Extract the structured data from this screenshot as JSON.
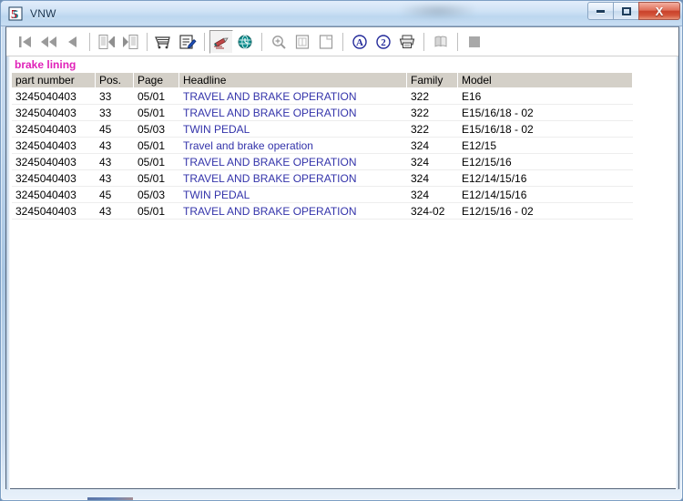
{
  "window": {
    "title": "VNW",
    "app_icon": "app-5-icon",
    "controls": {
      "minimize": "Minimize",
      "maximize": "Maximize",
      "close": "X"
    }
  },
  "toolbar": {
    "buttons": [
      {
        "name": "first-record-button",
        "icon": "skip-to-first-icon",
        "state": "disabled"
      },
      {
        "name": "rewind-button",
        "icon": "rewind-icon",
        "state": "disabled"
      },
      {
        "name": "previous-record-button",
        "icon": "previous-icon",
        "state": "disabled"
      },
      {
        "name": "sep-1",
        "icon": "separator",
        "state": "separator"
      },
      {
        "name": "first-document-button",
        "icon": "document-first-icon",
        "state": "disabled"
      },
      {
        "name": "next-document-button",
        "icon": "document-next-icon",
        "state": "disabled"
      },
      {
        "name": "sep-2",
        "icon": "separator",
        "state": "separator"
      },
      {
        "name": "shopping-cart-button",
        "icon": "shopping-cart-icon",
        "state": "enabled"
      },
      {
        "name": "edit-list-button",
        "icon": "edit-checklist-icon",
        "state": "enabled"
      },
      {
        "name": "sep-3",
        "icon": "separator",
        "state": "separator"
      },
      {
        "name": "annotate-button",
        "icon": "pen-nib-icon",
        "state": "pressed"
      },
      {
        "name": "globe-button",
        "icon": "globe-clock-icon",
        "state": "enabled"
      },
      {
        "name": "sep-4",
        "icon": "separator",
        "state": "separator"
      },
      {
        "name": "zoom-button",
        "icon": "magnifier-plus-icon",
        "state": "disabled"
      },
      {
        "name": "page-view-button",
        "icon": "page-icon",
        "state": "disabled"
      },
      {
        "name": "page-copy-button",
        "icon": "page-copy-icon",
        "state": "disabled"
      },
      {
        "name": "sep-5",
        "icon": "separator",
        "state": "separator"
      },
      {
        "name": "language-a-button",
        "icon": "circled-a-icon",
        "state": "enabled"
      },
      {
        "name": "language-2-button",
        "icon": "circled-2-icon",
        "state": "enabled"
      },
      {
        "name": "print-button",
        "icon": "printer-icon",
        "state": "enabled"
      },
      {
        "name": "sep-6",
        "icon": "separator",
        "state": "separator"
      },
      {
        "name": "book-button",
        "icon": "book-icon",
        "state": "disabled"
      },
      {
        "name": "sep-7",
        "icon": "separator",
        "state": "separator"
      },
      {
        "name": "stop-button",
        "icon": "stop-square-icon",
        "state": "disabled"
      }
    ]
  },
  "search": {
    "term": "brake lining",
    "term_color": "#e020b8"
  },
  "table": {
    "columns": [
      {
        "key": "part_number",
        "label": "part number"
      },
      {
        "key": "pos",
        "label": "Pos."
      },
      {
        "key": "page",
        "label": "Page"
      },
      {
        "key": "headline",
        "label": "Headline"
      },
      {
        "key": "family",
        "label": "Family"
      },
      {
        "key": "model",
        "label": "Model"
      }
    ],
    "link_color": "#3333aa",
    "rows": [
      {
        "part_number": "3245040403",
        "pos": "33",
        "page": "05/01",
        "headline": "TRAVEL AND BRAKE OPERATION",
        "family": "322",
        "model": "E16"
      },
      {
        "part_number": "3245040403",
        "pos": "33",
        "page": "05/01",
        "headline": "TRAVEL AND BRAKE OPERATION",
        "family": "322",
        "model": "E15/16/18 - 02"
      },
      {
        "part_number": "3245040403",
        "pos": "45",
        "page": "05/03",
        "headline": "TWIN PEDAL",
        "family": "322",
        "model": "E15/16/18 - 02"
      },
      {
        "part_number": "3245040403",
        "pos": "43",
        "page": "05/01",
        "headline": "Travel and brake operation",
        "family": "324",
        "model": "E12/15"
      },
      {
        "part_number": "3245040403",
        "pos": "43",
        "page": "05/01",
        "headline": "TRAVEL AND BRAKE OPERATION",
        "family": "324",
        "model": "E12/15/16"
      },
      {
        "part_number": "3245040403",
        "pos": "43",
        "page": "05/01",
        "headline": "TRAVEL AND BRAKE OPERATION",
        "family": "324",
        "model": "E12/14/15/16"
      },
      {
        "part_number": "3245040403",
        "pos": "45",
        "page": "05/03",
        "headline": "TWIN PEDAL",
        "family": "324",
        "model": "E12/14/15/16"
      },
      {
        "part_number": "3245040403",
        "pos": "43",
        "page": "05/01",
        "headline": "TRAVEL AND BRAKE OPERATION",
        "family": "324-02",
        "model": "E12/15/16 - 02"
      }
    ]
  }
}
